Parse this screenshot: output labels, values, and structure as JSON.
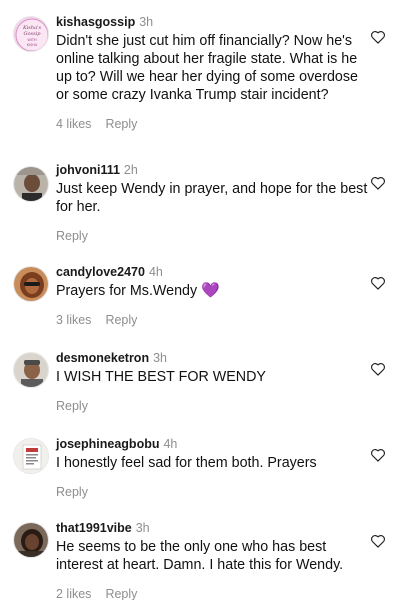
{
  "comments": [
    {
      "username": "kishasgossip",
      "time": "3h",
      "text": "Didn't she just cut him off financially? Now he's online talking about her fragile state. What is he up to? Will we hear her dying of some overdose or some crazy Ivanka Trump stair incident?",
      "likes": "4 likes",
      "reply": "Reply"
    },
    {
      "username": "johvoni111",
      "time": "2h",
      "text": "Just keep Wendy in prayer, and hope for the best for her.",
      "reply": "Reply"
    },
    {
      "username": "candylove2470",
      "time": "4h",
      "text": "Prayers for Ms.Wendy",
      "emoji": "💜",
      "likes": "3 likes",
      "reply": "Reply"
    },
    {
      "username": "desmoneketron",
      "time": "3h",
      "text": "I WISH THE BEST FOR WENDY",
      "reply": "Reply"
    },
    {
      "username": "josephineagbobu",
      "time": "4h",
      "text": "I honestly feel sad for them both. Prayers",
      "reply": "Reply"
    },
    {
      "username": "that1991vibe",
      "time": "3h",
      "text": "He seems to be the only one who has best interest at heart. Damn. I hate this for Wendy.",
      "likes": "2 likes",
      "reply": "Reply"
    }
  ],
  "avatar_badge": {
    "line1": "Kisha's",
    "line2": "Gossip",
    "line3": "WITH",
    "line4": "KISHA"
  },
  "colors": {
    "username": "#1a1a1a",
    "meta": "#8e8e8e",
    "heart_outline": "#222222",
    "emoji_purple": "#8a3fd6"
  },
  "icons": {
    "like": "heart-outline-icon"
  }
}
